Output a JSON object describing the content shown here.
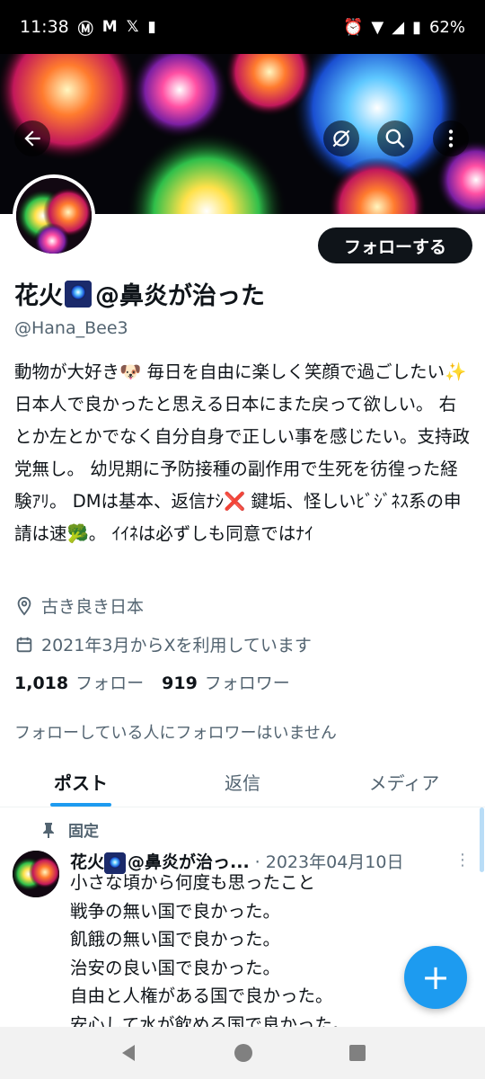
{
  "status_bar": {
    "time": "11:38",
    "battery": "62%",
    "notif_icons": [
      "motorola-icon",
      "gmail-icon",
      "x-icon",
      "sd-card-icon"
    ]
  },
  "banner": {
    "back_icon": "arrow-left-icon",
    "actions": [
      "translate-off-icon",
      "search-icon",
      "more-vertical-icon"
    ]
  },
  "profile": {
    "follow_label": "フォローする",
    "name_prefix": "花火",
    "name_suffix": "@鼻炎が治った",
    "handle": "@Hana_Bee3",
    "bio": "動物が大好き🐶 毎日を自由に楽しく笑顔で過ごしたい✨ 日本人で良かったと思える日本にまた戻って欲しい。 右とか左とかでなく自分自身で正しい事を感じたい。支持政党無し。 幼児期に予防接種の副作用で生死を彷徨った経験ｱﾘ。 DMは基本、返信ﾅｼ❌ 鍵垢、怪しいﾋﾞｼﾞﾈｽ系の申請は速🥦。 ｲｲﾈは必ずしも同意ではﾅｲ",
    "location": "古き良き日本",
    "joined": "2021年3月からXを利用しています",
    "following_count": "1,018",
    "following_label": "フォロー",
    "followers_count": "919",
    "followers_label": "フォロワー",
    "mutual_note": "フォローしている人にフォロワーはいません"
  },
  "tabs": [
    {
      "label": "ポスト",
      "active": true
    },
    {
      "label": "返信",
      "active": false
    },
    {
      "label": "メディア",
      "active": false
    }
  ],
  "pinned_post": {
    "pinned_label": "固定",
    "author_prefix": "花火",
    "author_suffix": "@鼻炎が治っ...",
    "date": "· 2023年04月10日",
    "body": "小さな頃から何度も思ったこと\n戦争の無い国で良かった。\n飢餓の無い国で良かった。\n治安の良い国で良かった。\n自由と人権がある国で良かった。\n安心して水が飲める国で良かった。"
  },
  "fab_label": "+",
  "colors": {
    "accent": "#1d9bf0",
    "text_primary": "#0f1419",
    "text_secondary": "#536471",
    "follow_button": "#0f1419"
  }
}
